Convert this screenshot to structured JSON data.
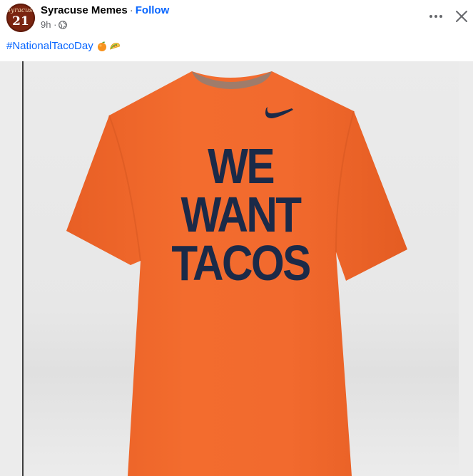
{
  "post": {
    "page_name": "Syracuse Memes",
    "separator": "·",
    "follow_label": "Follow",
    "timestamp": "9h ·",
    "audience_icon": "globe-icon",
    "avatar": {
      "script": "Syracuse",
      "number": "21"
    },
    "caption": {
      "hashtag": "#NationalTacoDay",
      "emojis": [
        "orange-emoji",
        "taco-emoji"
      ]
    }
  },
  "controls": {
    "more_icon": "more-horizontal-icon",
    "close_icon": "close-icon"
  },
  "image": {
    "shirt_text": [
      "WE",
      "WANT",
      "TACOS"
    ],
    "colors": {
      "shirt": "#f26a2e",
      "text": "#1b2a48",
      "swoosh": "#1b2a48"
    },
    "logo": "swoosh-logo"
  }
}
